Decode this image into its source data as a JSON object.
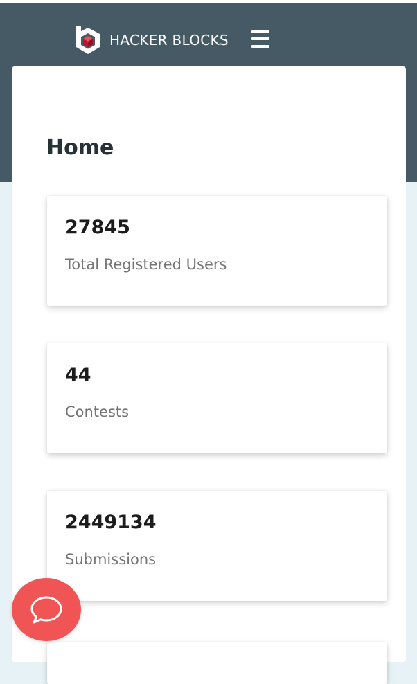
{
  "header": {
    "brand_name": "HACKER BLOCKS",
    "logo_icon": "hacker-blocks-logo",
    "menu_icon": "hamburger-menu-icon",
    "background_color": "#455a64"
  },
  "main": {
    "title": "Home",
    "stats": [
      {
        "value": "27845",
        "label": "Total Registered Users"
      },
      {
        "value": "44",
        "label": "Contests"
      },
      {
        "value": "2449134",
        "label": "Submissions"
      }
    ]
  },
  "chat": {
    "icon": "chat-bubble-icon",
    "color": "#f05454"
  },
  "colors": {
    "page_background": "#e6f2f5",
    "logo_red": "#c8102e"
  }
}
